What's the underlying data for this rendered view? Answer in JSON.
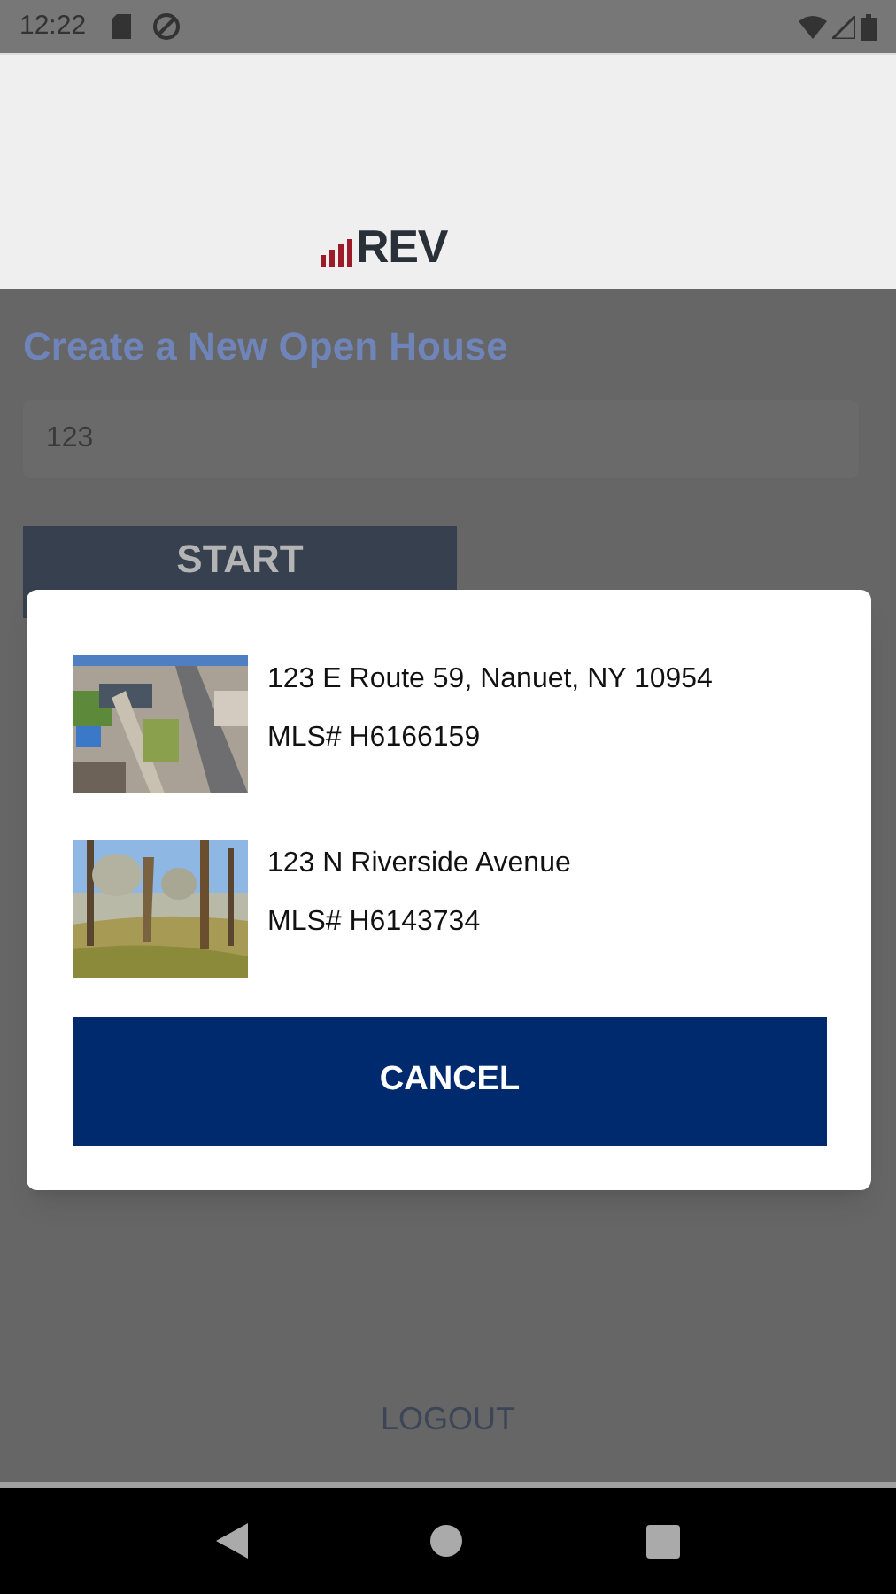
{
  "status_bar": {
    "time": "12:22"
  },
  "header": {
    "logo": "REV"
  },
  "form": {
    "title": "Create a New Open House",
    "address_field": {
      "value": "123"
    },
    "start_button": "START"
  },
  "dialog": {
    "listings": [
      {
        "address": "123 E Route 59, Nanuet, NY 10954",
        "mls": "MLS# H6166159"
      },
      {
        "address": "123 N Riverside Avenue",
        "mls": "MLS# H6143734"
      }
    ],
    "cancel_button": "CANCEL"
  },
  "logout_link": "LOGOUT"
}
